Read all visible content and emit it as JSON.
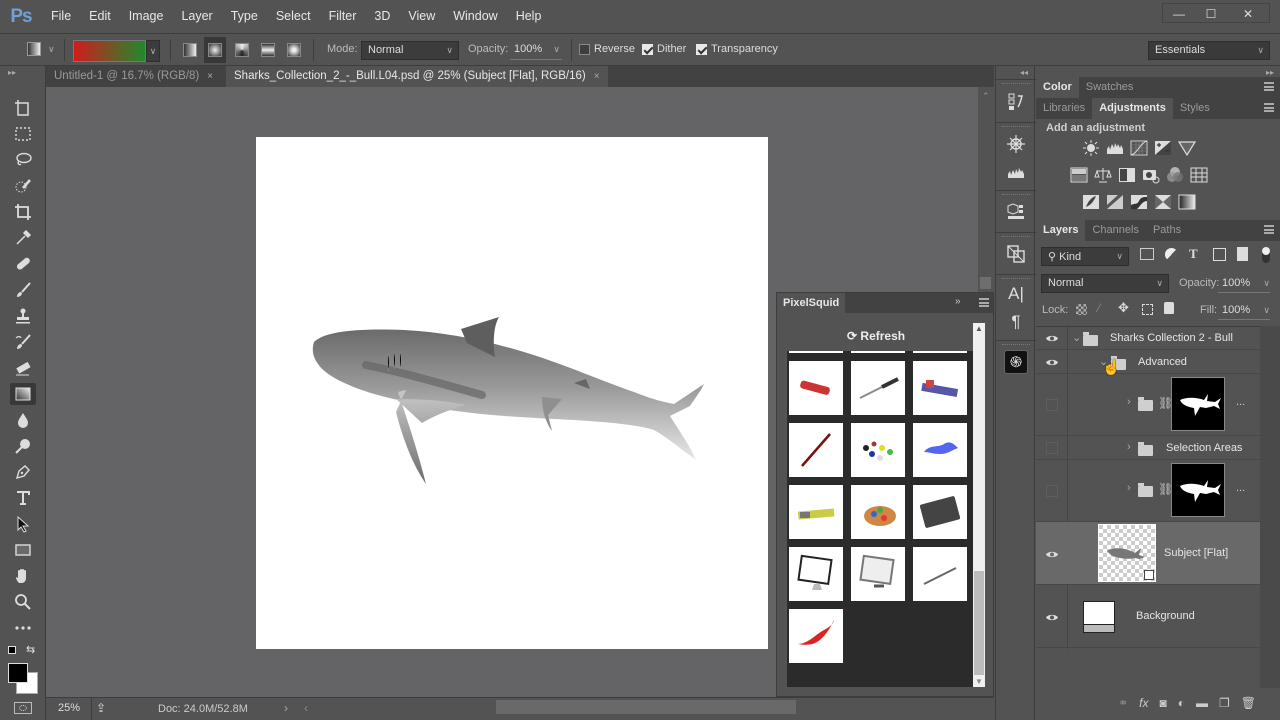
{
  "app": {
    "logo": "Ps"
  },
  "menubar": {
    "items": [
      "File",
      "Edit",
      "Image",
      "Layer",
      "Type",
      "Select",
      "Filter",
      "3D",
      "View",
      "Window",
      "Help"
    ]
  },
  "window_controls": {
    "minimize": "—",
    "maximize": "☐",
    "close": "✕"
  },
  "options_bar": {
    "tool": "Gradient",
    "gradient_colors": [
      "#d01c1c",
      "#1f8a2c"
    ],
    "gradient_types": [
      "Linear",
      "Radial",
      "Angle",
      "Reflected",
      "Diamond"
    ],
    "active_gradient_type": "Radial",
    "mode_label": "Mode:",
    "mode_value": "Normal",
    "opacity_label": "Opacity:",
    "opacity_value": "100%",
    "reverse_label": "Reverse",
    "reverse_checked": false,
    "dither_label": "Dither",
    "dither_checked": true,
    "transparency_label": "Transparency",
    "transparency_checked": true,
    "workspace": "Essentials"
  },
  "document_tabs": [
    {
      "title": "Untitled-1 @ 16.7% (RGB/8)",
      "active": false
    },
    {
      "title": "Sharks_Collection_2_-_Bull.L04.psd @ 25% (Subject [Flat], RGB/16)",
      "active": true
    }
  ],
  "tab_close": "×",
  "toolbar": {
    "tools": [
      "Artboard",
      "Rectangular Marquee",
      "Lasso",
      "Quick Selection",
      "Crop",
      "Eyedropper",
      "Healing Brush",
      "Brush",
      "Clone Stamp",
      "History Brush",
      "Eraser",
      "Gradient",
      "Blur",
      "Dodge",
      "Pen",
      "Type",
      "Path Selection",
      "Rectangle",
      "Hand",
      "Zoom",
      "Edit Toolbar"
    ],
    "active_tool": "Gradient",
    "foreground_color": "#000000",
    "background_color": "#ffffff"
  },
  "status_bar": {
    "zoom": "25%",
    "doc_info": "Doc: 24.0M/52.8M"
  },
  "panels": {
    "color_tabs": [
      "Color",
      "Swatches"
    ],
    "adjust_tabs": [
      "Libraries",
      "Adjustments",
      "Styles"
    ],
    "adjust_heading": "Add an adjustment",
    "adjustment_icons": [
      [
        "brightness-contrast",
        "levels",
        "curves",
        "exposure",
        "gradient-filter"
      ],
      [
        "vibrance",
        "color-balance",
        "black-white",
        "photo-filter",
        "channel-mixer",
        "color-lookup"
      ],
      [
        "invert",
        "posterize",
        "threshold",
        "selective-color",
        "gradient-map"
      ]
    ],
    "layers_tabs": [
      "Layers",
      "Channels",
      "Paths"
    ],
    "filter_kind": "Kind",
    "blend_mode": "Normal",
    "opacity_label": "Opacity:",
    "opacity_value": "100%",
    "lock_label": "Lock:",
    "fill_label": "Fill:",
    "fill_value": "100%"
  },
  "layers": [
    {
      "name": "Sharks Collection 2 - Bull",
      "type": "group",
      "visible": true,
      "expanded": true
    },
    {
      "name": "Advanced",
      "type": "group",
      "visible": true,
      "expanded": true
    },
    {
      "name": "",
      "type": "group-masked",
      "visible": false,
      "menu": "..."
    },
    {
      "name": "Selection Areas",
      "type": "group",
      "visible": false
    },
    {
      "name": "",
      "type": "group-masked",
      "visible": false,
      "menu": "..."
    },
    {
      "name": "Subject [Flat]",
      "type": "smart-object",
      "visible": true,
      "selected": true
    },
    {
      "name": "Background",
      "type": "background",
      "visible": true
    }
  ],
  "pixelsquid": {
    "title": "PixelSquid",
    "refresh_label": "Refresh",
    "thumbnails": [
      "paint-tube-red",
      "knife",
      "paint-tubes",
      "paintbrush",
      "paint-dots",
      "blue-splash",
      "paint-tubes-yellow",
      "paint-palette",
      "drawing-tablet",
      "imac-monitor",
      "display-monitor",
      "stylus-pen",
      "red-splash"
    ]
  }
}
